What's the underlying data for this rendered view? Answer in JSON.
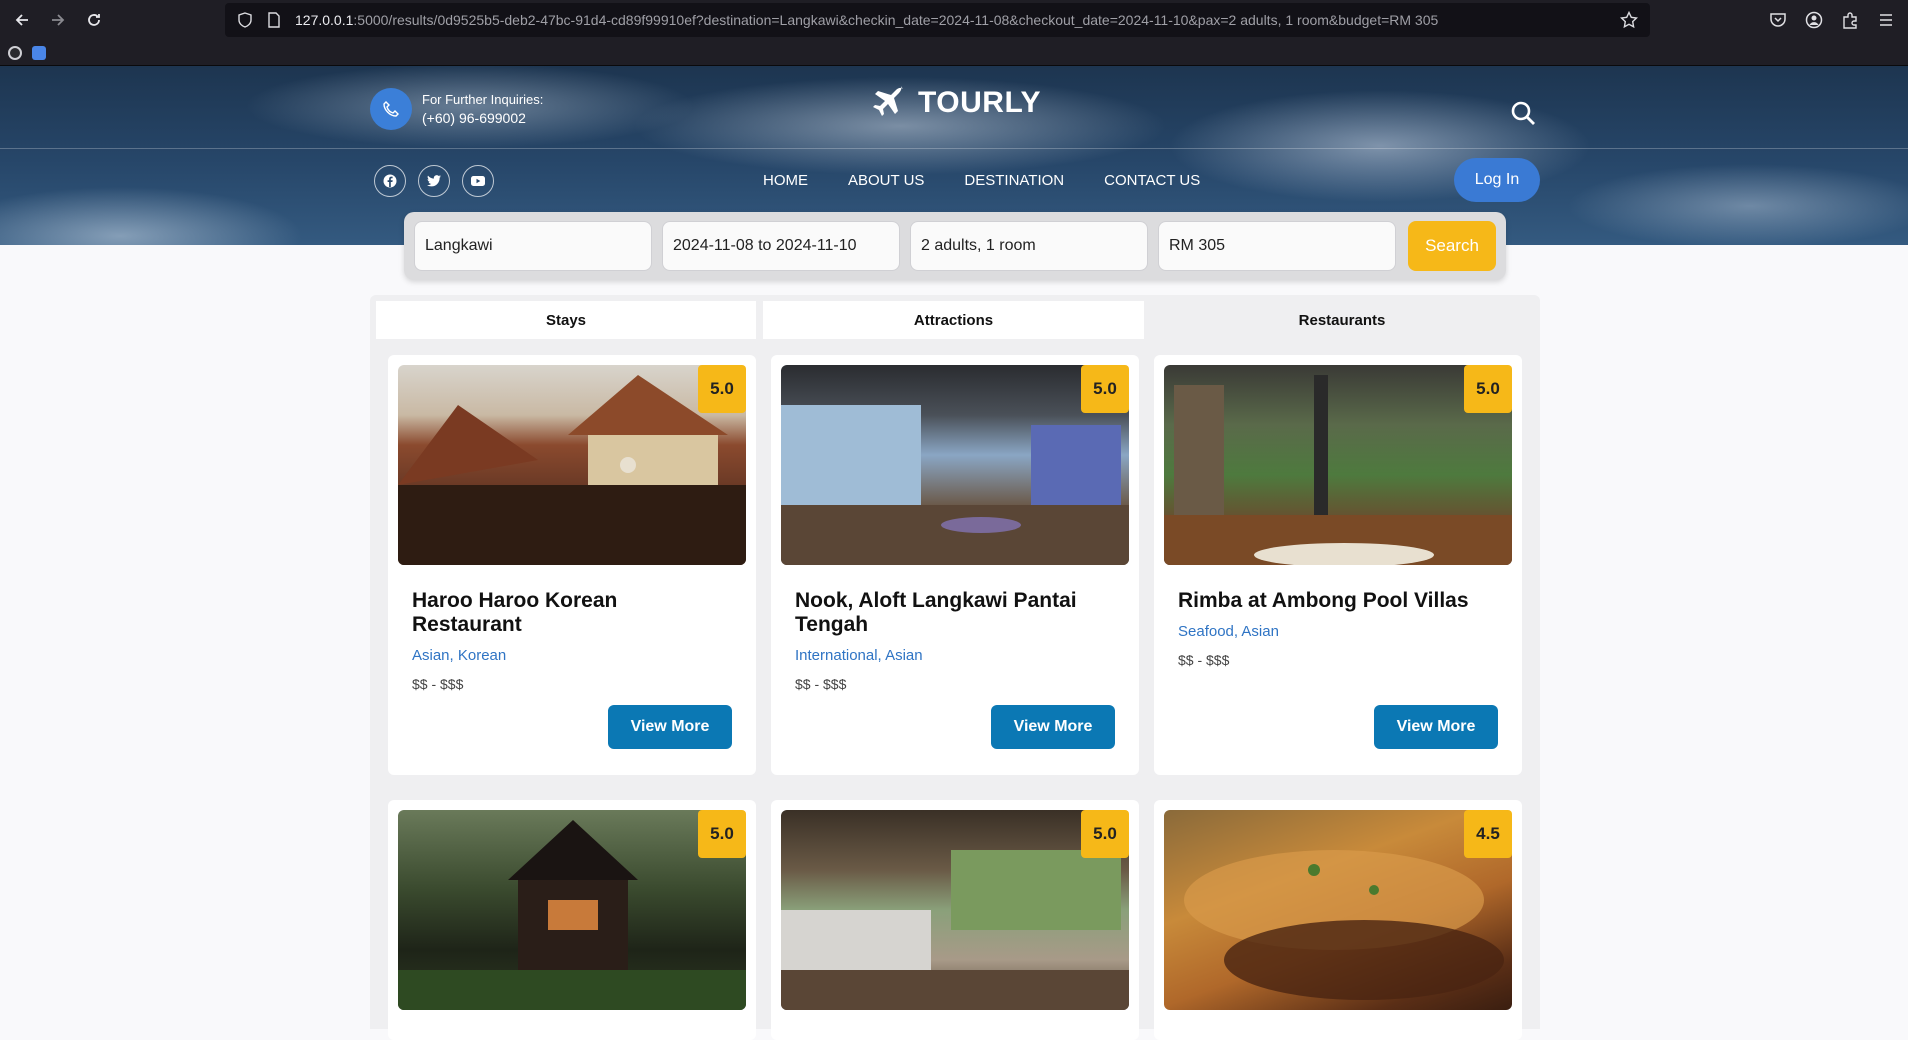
{
  "browser": {
    "url_host": "127.0.0.1",
    "url_rest": ":5000/results/0d9525b5-deb2-47bc-91d4-cd89f99910ef?destination=Langkawi&checkin_date=2024-11-08&checkout_date=2024-11-10&pax=2 adults, 1 room&budget=RM 305"
  },
  "header": {
    "inquiry_label": "For Further Inquiries:",
    "phone": "(+60) 96-699002",
    "brand": "TOURLY",
    "nav": [
      "HOME",
      "ABOUT US",
      "DESTINATION",
      "CONTACT US"
    ],
    "login": "Log In"
  },
  "search": {
    "destination": "Langkawi",
    "dates": "2024-11-08 to 2024-11-10",
    "pax": "2 adults, 1 room",
    "budget": "RM 305",
    "button": "Search"
  },
  "tabs": [
    "Stays",
    "Attractions",
    "Restaurants"
  ],
  "cards": [
    {
      "rating": "5.0",
      "name": "Haroo Haroo Korean Restaurant",
      "cuisine": "Asian, Korean",
      "price": "$$ - $$$",
      "button": "View More"
    },
    {
      "rating": "5.0",
      "name": "Nook, Aloft Langkawi Pantai Tengah",
      "cuisine": "International, Asian",
      "price": "$$ - $$$",
      "button": "View More"
    },
    {
      "rating": "5.0",
      "name": "Rimba at Ambong Pool Villas",
      "cuisine": "Seafood, Asian",
      "price": "$$ - $$$",
      "button": "View More"
    },
    {
      "rating": "5.0"
    },
    {
      "rating": "5.0"
    },
    {
      "rating": "4.5"
    }
  ],
  "colors": {
    "accent": "#f6b818",
    "primary_button": "#0b78b4",
    "login": "#3a7ad4",
    "link": "#2f74c4"
  }
}
